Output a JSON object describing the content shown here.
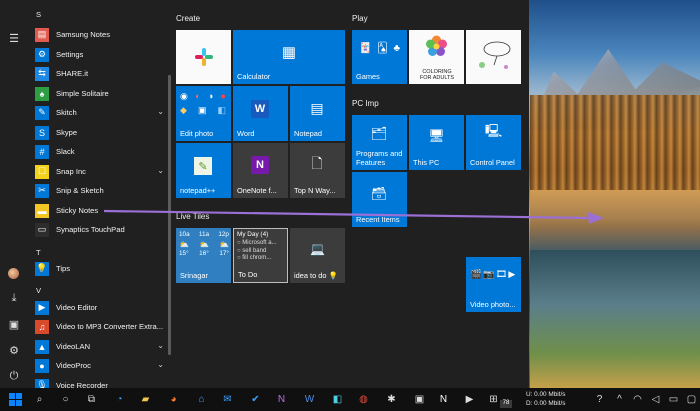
{
  "app_list": {
    "letters": {
      "s": "S",
      "t": "T",
      "v": "V"
    },
    "items": [
      {
        "label": "Samsung Notes",
        "icon": "samsung-notes-icon",
        "color": "#e05a4f",
        "glyph": "▤"
      },
      {
        "label": "Settings",
        "icon": "gear-icon",
        "color": "#0078d7",
        "glyph": "⚙"
      },
      {
        "label": "SHARE.it",
        "icon": "shareit-icon",
        "color": "#1e88e5",
        "glyph": "⇆"
      },
      {
        "label": "Simple Solitaire",
        "icon": "solitaire-icon",
        "color": "#2e9e45",
        "glyph": "♠"
      },
      {
        "label": "Skitch",
        "icon": "skitch-icon",
        "color": "#0078d7",
        "glyph": "✎",
        "chevron": true
      },
      {
        "label": "Skype",
        "icon": "skype-icon",
        "color": "#0078d7",
        "glyph": "S"
      },
      {
        "label": "Slack",
        "icon": "slack-icon",
        "color": "#0078d7",
        "glyph": "#"
      },
      {
        "label": "Snap Inc",
        "icon": "snap-icon",
        "color": "#f2d21b",
        "glyph": "☐",
        "chevron": true
      },
      {
        "label": "Snip & Sketch",
        "icon": "snip-sketch-icon",
        "color": "#0078d7",
        "glyph": "✂"
      },
      {
        "label": "Sticky Notes",
        "icon": "sticky-notes-icon",
        "color": "#f3c623",
        "glyph": "▬"
      },
      {
        "label": "Synaptics TouchPad",
        "icon": "touchpad-icon",
        "color": "#2d2d2d",
        "glyph": "▭"
      },
      {
        "label": "Tips",
        "icon": "tips-icon",
        "color": "#0078d7",
        "glyph": "💡"
      },
      {
        "label": "Video Editor",
        "icon": "video-editor-icon",
        "color": "#0078d7",
        "glyph": "▶"
      },
      {
        "label": "Video to MP3 Converter Extra...",
        "icon": "mp3-converter-icon",
        "color": "#d94a2b",
        "glyph": "♫"
      },
      {
        "label": "VideoLAN",
        "icon": "videolan-icon",
        "color": "#0078d7",
        "glyph": "▲",
        "chevron": true
      },
      {
        "label": "VideoProc",
        "icon": "videoproc-icon",
        "color": "#0078d7",
        "glyph": "●",
        "chevron": true
      },
      {
        "label": "Voice Recorder",
        "icon": "voice-recorder-icon",
        "color": "#0078d7",
        "glyph": "🎙"
      }
    ]
  },
  "groups": {
    "create": "Create",
    "play": "Play",
    "pc_imp": "PC Imp",
    "live_tiles": "Live Tiles"
  },
  "tiles": {
    "calculator": "Calculator",
    "edit_photo": "Edit photo",
    "word": "Word",
    "notepad": "Notepad",
    "notepadpp": "notepad++",
    "onenote": "OneNote f...",
    "top_n_ways": "Top N Way...",
    "games": "Games",
    "coloring": "COLORING FOR ADULTS",
    "programs_features": "Programs and Features",
    "this_pc": "This PC",
    "control_panel": "Control Panel",
    "recent_items": "Recent Items",
    "weather": {
      "times": [
        "10a",
        "11a",
        "12p"
      ],
      "temps": [
        "15°",
        "16°",
        "17°"
      ],
      "city": "Srinagar"
    },
    "todo": {
      "header": "My Day (4)",
      "tasks": [
        "Microsoft a...",
        "sell band",
        "fill chrom..."
      ],
      "label": "To Do"
    },
    "idea": "idea to do 💡",
    "video_photo": "Video photo..."
  },
  "taskbar": {
    "network_up": "U: 0.00 Mbit/s",
    "network_down": "D: 0.00 Mbit/s",
    "badge_count": "78"
  },
  "colors": {
    "accent": "#0078d7",
    "annotation_arrow": "#9a6fd6",
    "start_bg": "#202020"
  }
}
